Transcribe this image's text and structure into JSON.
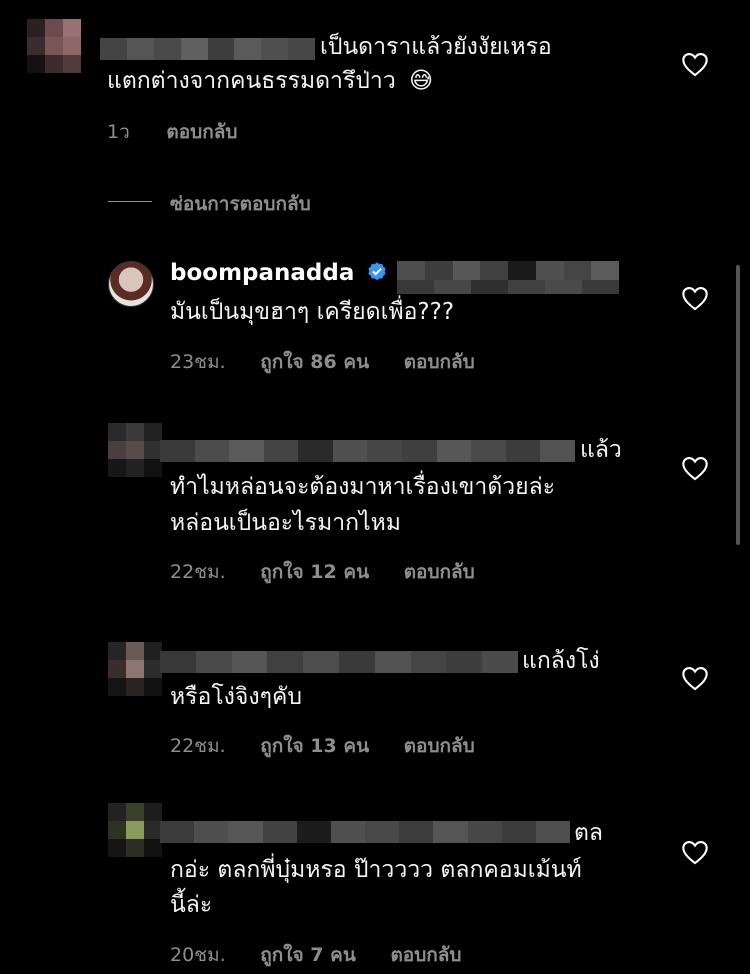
{
  "comments": [
    {
      "text_line1": "เป็นดาราแล้วยังงัยเหรอ",
      "text_line2": "แตกต่างจากคนธรรมดารึป่าว",
      "emoji": "😅",
      "time": "1ว",
      "reply": "ตอบกลับ"
    }
  ],
  "hide_replies": "ซ่อนการตอบกลับ",
  "replies": [
    {
      "username": "boompanadda",
      "verified": true,
      "text": "มันเป็นมุขฮาๆ เครียดเพื่อ???",
      "time": "23ชม.",
      "likes": "ถูกใจ 86 คน",
      "reply": "ตอบกลับ"
    },
    {
      "tail": "แล้ว",
      "line2": "ทำไมหล่อนจะต้องมาหาเรื่องเขาด้วยล่ะ",
      "line3": "หล่อนเป็นอะไรมากไหม",
      "time": "22ชม.",
      "likes": "ถูกใจ 12 คน",
      "reply": "ตอบกลับ"
    },
    {
      "tail": "แกล้งโง่",
      "line2": "หรือโง่จิงๆคับ",
      "time": "22ชม.",
      "likes": "ถูกใจ 13 คน",
      "reply": "ตอบกลับ"
    },
    {
      "tail": "ตล",
      "line2": "กอ่ะ ตลกพี่บุ๋มหรอ ป๊าวววว ตลกคอมเม้นท์",
      "line3": "นี้ล่ะ",
      "time": "20ชม.",
      "likes": "ถูกใจ 7 คน",
      "reply": "ตอบกลับ"
    }
  ]
}
